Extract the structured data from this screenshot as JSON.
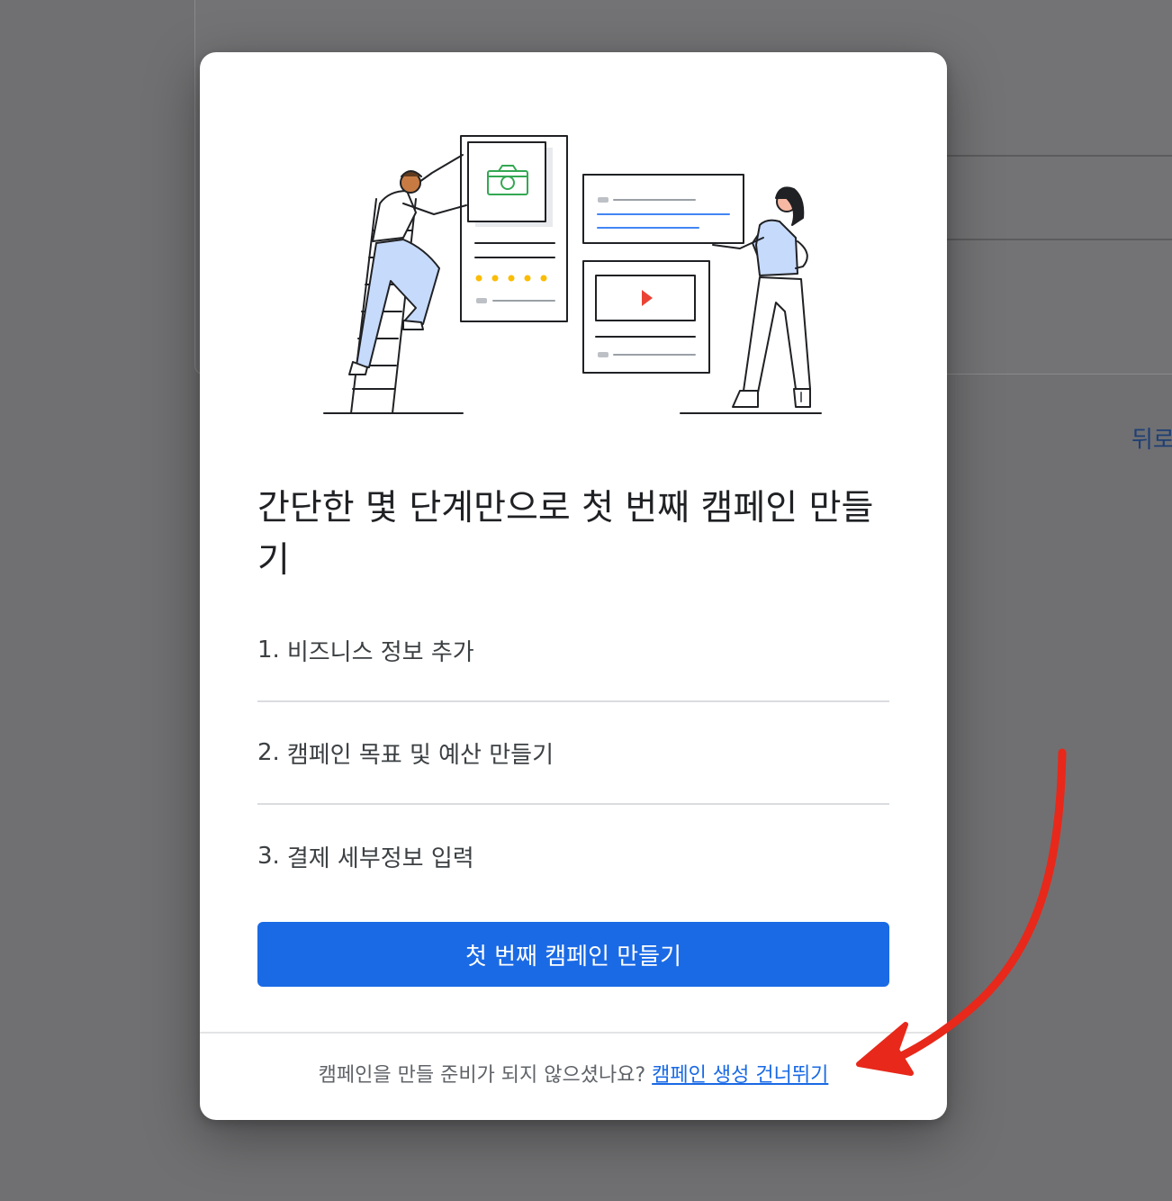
{
  "background": {
    "back_label": "뒤로"
  },
  "modal": {
    "title": "간단한 몇 단계만으로 첫 번째 캠페인 만들기",
    "steps": [
      {
        "num": "1.",
        "label": "비즈니스 정보 추가"
      },
      {
        "num": "2.",
        "label": "캠페인 목표 및 예산 만들기"
      },
      {
        "num": "3.",
        "label": "결제 세부정보 입력"
      }
    ],
    "primary_button": "첫 번째 캠페인 만들기",
    "footer_text": "캠페인을 만들 준비가 되지 않으셨나요?",
    "skip_link": "캠페인 생성 건너뛰기"
  },
  "colors": {
    "primary": "#1a6ae5",
    "overlay": "#707072",
    "annotation": "#e8281a"
  },
  "icons": [
    "camera-icon",
    "play-icon"
  ]
}
